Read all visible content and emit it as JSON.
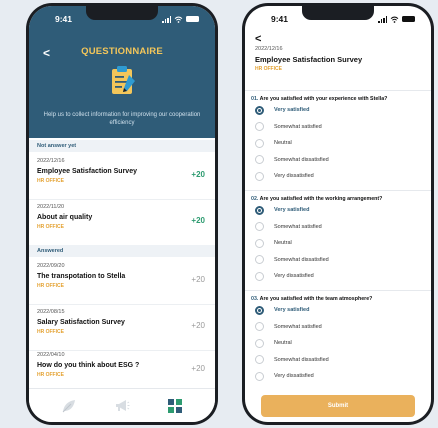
{
  "list_screen": {
    "status_time": "9:41",
    "header": {
      "title": "QUESTIONNAIRE",
      "description": "Help us to collect information for improving our cooperation efficiency"
    },
    "sections": {
      "pending_label": "Not answer yet",
      "answered_label": "Answered"
    },
    "pending": [
      {
        "date": "2022/12/16",
        "title": "Employee Satisfaction Survey",
        "dept": "HR OFFICE",
        "points": "+20"
      },
      {
        "date": "2022/11/20",
        "title": "About air quality",
        "dept": "HR OFFICE",
        "points": "+20"
      }
    ],
    "answered": [
      {
        "date": "2022/09/20",
        "title": "The transpotation to Stella",
        "dept": "HR OFFICE",
        "points": "+20"
      },
      {
        "date": "2022/08/15",
        "title": "Salary Satisfaction Survey",
        "dept": "HR OFFICE",
        "points": "+20"
      },
      {
        "date": "2022/04/10",
        "title": "How do you think about ESG ?",
        "dept": "HR OFFICE",
        "points": "+20"
      }
    ],
    "tabbar": {
      "tabs": [
        {
          "icon": "leaf-icon",
          "active": false
        },
        {
          "icon": "megaphone-icon",
          "active": false
        },
        {
          "icon": "grid-icon",
          "active": true
        }
      ]
    }
  },
  "detail_screen": {
    "status_time": "9:41",
    "back_glyph": "<",
    "date": "2022/12/16",
    "title": "Employee Satisfaction Survey",
    "dept": "HR OFFICE",
    "questions": [
      {
        "number": "01.",
        "text": "Are you satisfied with your experience with Stella?",
        "options": [
          "Very satisfied",
          "Somewhat satisfied",
          "Neutral",
          "Somewhat dissatisfied",
          "Very dissatisfied"
        ],
        "selected": 0
      },
      {
        "number": "02.",
        "text": "Are you satisfied with the working arrangement?",
        "options": [
          "Very satisfied",
          "Somewhat satisfied",
          "Neutral",
          "Somewhat dissatisfied",
          "Very dissatisfied"
        ],
        "selected": 0
      },
      {
        "number": "03.",
        "text": "Are you satisfied with the team atmosphere?",
        "options": [
          "Very satisfied",
          "Somewhat satisfied",
          "Neutral",
          "Somewhat dissatisfied",
          "Very dissatisfied"
        ],
        "selected": 0
      }
    ],
    "submit_label": "Submit"
  },
  "colors": {
    "header_bg": "#2f5c78",
    "title_accent": "#f3c65a",
    "dept_accent": "#e4a232",
    "points_active": "#2d9b70",
    "submit_bg": "#eab15c"
  }
}
